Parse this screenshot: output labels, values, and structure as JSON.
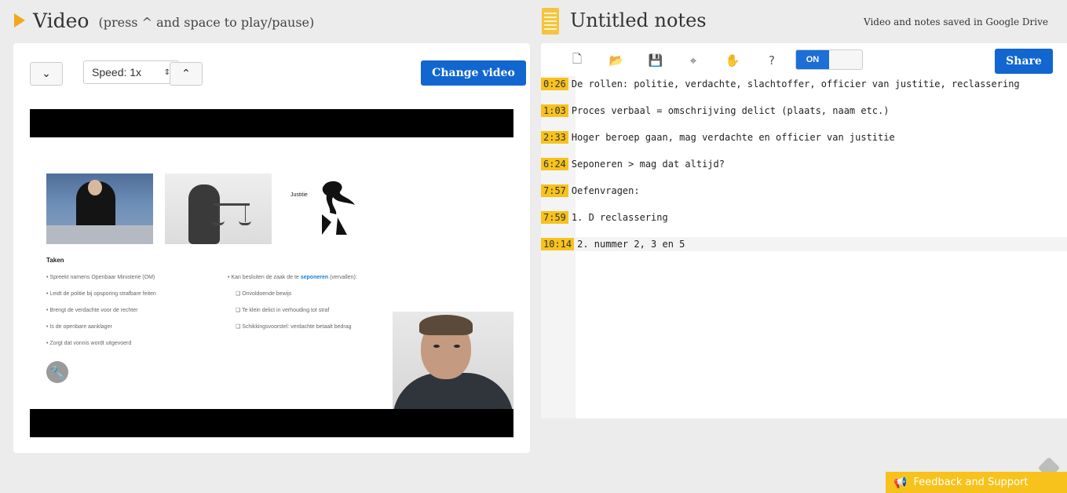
{
  "video": {
    "title": "Video",
    "hint": "(press ^ and space to play/pause)",
    "speed_label": "Speed: 1x",
    "change_video_label": "Change video",
    "down_label": "⌄",
    "up_label": "⌃",
    "slide": {
      "justitie_label": "Justitie",
      "title": "Taken",
      "left_bullets": [
        "• Spreekt namens Openbaar Ministerie (OM)",
        "• Leidt de politie bij opsporing strafbare feiten",
        "• Brengt de verdachte voor de rechter",
        "• Is de openbare aanklager",
        "• Zorgt dat vonnis wordt uitgevoerd"
      ],
      "right_bullets": {
        "prefix": "• Kan besluiten de zaak de te ",
        "highlight": "seponeren",
        "suffix": " (vervallen):",
        "sub": [
          "❑   Onvoldoende bewijs",
          "❑   Te klein delict in verhouding tot straf",
          "❑   Schikkingsvoorstel: verdachte betaalt bedrag"
        ]
      }
    }
  },
  "notes": {
    "title": "Untitled notes",
    "saved_status": "Video and notes saved in Google Drive",
    "toggle_label": "ON",
    "share_label": "Share",
    "toolbar_icons": [
      "new-file-icon",
      "open-folder-icon",
      "save-icon",
      "crosshair-icon",
      "hand-icon",
      "help-icon"
    ],
    "lines": [
      {
        "ts": "0:26",
        "text": "De rollen: politie, verdachte, slachtoffer, officier van justitie, reclassering"
      },
      {
        "ts": "1:03",
        "text": "Proces verbaal = omschrijving delict (plaats, naam etc.)"
      },
      {
        "ts": "2:33",
        "text": "Hoger beroep gaan, mag verdachte en officier van justitie"
      },
      {
        "ts": "6:24",
        "text": "Seponeren > mag dat altijd?"
      },
      {
        "ts": "7:57",
        "text": "Oefenvragen:"
      },
      {
        "ts": "7:59",
        "text": "1. D reclassering"
      },
      {
        "ts": "10:14",
        "text": "2. nummer 2, 3 en 5"
      }
    ]
  },
  "feedback": {
    "label": "Feedback and Support"
  },
  "colors": {
    "accent_blue": "#1166d0",
    "timestamp_yellow": "#f7c21b",
    "play_orange": "#f0a81c"
  }
}
